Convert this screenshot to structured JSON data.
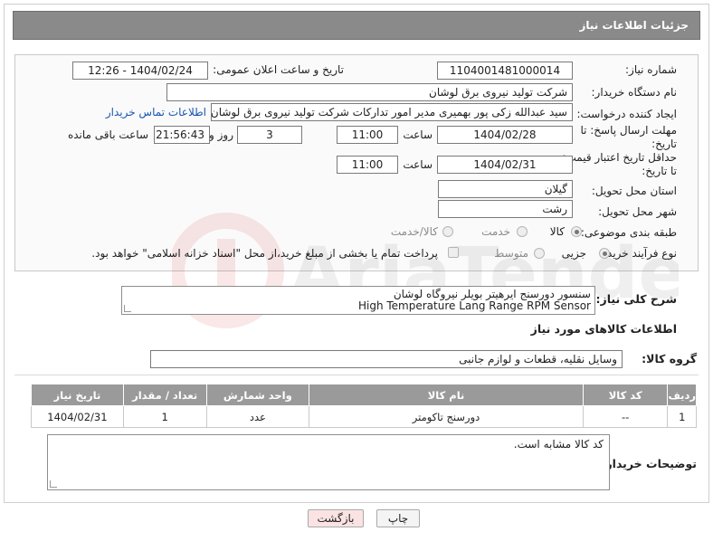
{
  "header": {
    "title": "جزئیات اطلاعات نیاز"
  },
  "form": {
    "need_number": {
      "label": "شماره نیاز:",
      "value": "1104001481000014"
    },
    "announce_datetime": {
      "label": "تاریخ و ساعت اعلان عمومی:",
      "value": "1404/02/24 - 12:26"
    },
    "buyer_org": {
      "label": "نام دستگاه خریدار:",
      "value": "شرکت تولید نیروی برق لوشان"
    },
    "creator": {
      "label": "ایجاد کننده درخواست:",
      "value": "سید عبدالله زکی پور بهمیری مدیر امور تدارکات شرکت تولید نیروی برق لوشان",
      "contact_link": "اطلاعات تماس خریدار"
    },
    "response_deadline": {
      "label": "مهلت ارسال پاسخ: تا تاریخ:",
      "date": "1404/02/28",
      "time_label": "ساعت",
      "time": "11:00",
      "days": "3",
      "days_label": "روز و",
      "remaining": "21:56:43",
      "remaining_label": "ساعت باقی مانده"
    },
    "price_validity": {
      "label": "حداقل تاریخ اعتبار قیمت: تا تاریخ:",
      "date": "1404/02/31",
      "time_label": "ساعت",
      "time": "11:00"
    },
    "delivery_province": {
      "label": "استان محل تحویل:",
      "value": "گیلان"
    },
    "delivery_city": {
      "label": "شهر محل تحویل:",
      "value": "رشت"
    },
    "category": {
      "label": "طبقه بندی موضوعی:",
      "options": [
        "کالا",
        "خدمت",
        "کالا/خدمت"
      ],
      "selected": "کالا"
    },
    "purchase_process": {
      "label": "نوع فرآیند خرید :",
      "options": [
        "جزیی",
        "متوسط"
      ],
      "selected": "جزیی",
      "payment_note": "پرداخت تمام یا بخشی از مبلغ خرید،از محل \"اسناد خزانه اسلامی\" خواهد بود."
    }
  },
  "description": {
    "label": "شرح کلی نیاز:",
    "line1": "سنسور دورسنج ایرهیتر بویلر نیروگاه لوشان",
    "line2": "High Temperature Lang Range RPM Sensor"
  },
  "goods_section": {
    "title": "اطلاعات کالاهای مورد نیاز",
    "group_label": "گروه کالا:",
    "group_value": "وسایل نقلیه، قطعات و لوازم جانبی"
  },
  "table": {
    "headers": [
      "ردیف",
      "کد کالا",
      "نام کالا",
      "واحد شمارش",
      "تعداد / مقدار",
      "تاریخ نیاز"
    ],
    "rows": [
      {
        "row": "1",
        "code": "--",
        "name": "دورسنج تاکومتر",
        "unit": "عدد",
        "qty": "1",
        "date": "1404/02/31"
      }
    ]
  },
  "buyer_notes": {
    "label": "توضیحات خریدار:",
    "value": "کد کالا مشابه است."
  },
  "buttons": {
    "print": "چاپ",
    "back": "بازگشت"
  },
  "colors": {
    "header_bg": "#8a8a8a",
    "link": "#1a56b0",
    "back_button_bg": "#fbe3e3"
  }
}
